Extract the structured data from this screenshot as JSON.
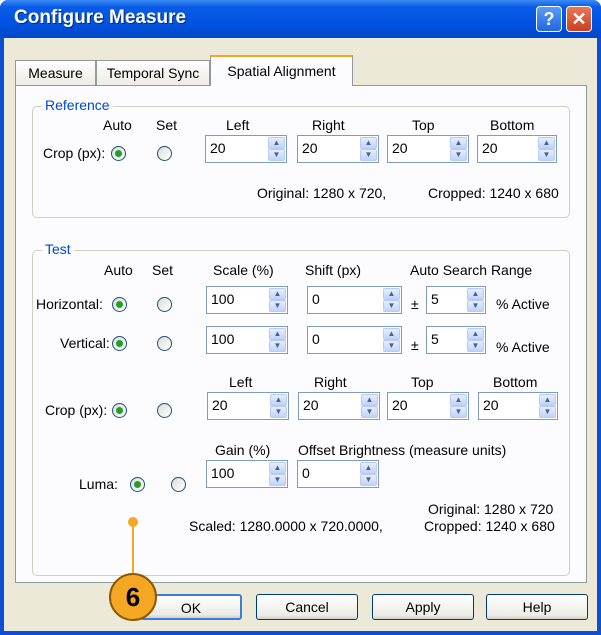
{
  "window": {
    "title": "Configure Measure",
    "help_glyph": "?",
    "close_glyph": "✕"
  },
  "tabs": [
    {
      "label": "Measure"
    },
    {
      "label": "Temporal Sync"
    },
    {
      "label": "Spatial Alignment"
    }
  ],
  "reference": {
    "group_label": "Reference",
    "col_auto": "Auto",
    "col_set": "Set",
    "col_left": "Left",
    "col_right": "Right",
    "col_top": "Top",
    "col_bottom": "Bottom",
    "crop_label": "Crop (px):",
    "crop_mode": "auto",
    "crop_values": {
      "left": "20",
      "right": "20",
      "top": "20",
      "bottom": "20"
    },
    "original_text": "Original: 1280 x 720,",
    "cropped_text": "Cropped: 1240 x 680"
  },
  "test": {
    "group_label": "Test",
    "col_auto": "Auto",
    "col_set": "Set",
    "col_scale": "Scale (%)",
    "col_shift": "Shift (px)",
    "col_search": "Auto Search Range",
    "horizontal": {
      "label": "Horizontal:",
      "mode": "auto",
      "scale": "100",
      "shift": "0",
      "pm": "±",
      "range": "5",
      "unit": "% Active"
    },
    "vertical": {
      "label": "Vertical:",
      "mode": "auto",
      "scale": "100",
      "shift": "0",
      "pm": "±",
      "range": "5",
      "unit": "% Active"
    },
    "col_left": "Left",
    "col_right": "Right",
    "col_top": "Top",
    "col_bottom": "Bottom",
    "crop_label": "Crop (px):",
    "crop_mode": "auto",
    "crop_values": {
      "left": "20",
      "right": "20",
      "top": "20",
      "bottom": "20"
    },
    "col_gain": "Gain (%)",
    "col_offset": "Offset Brightness (measure units)",
    "luma": {
      "label": "Luma:",
      "mode": "auto",
      "gain": "100",
      "offset": "0"
    },
    "original_text": "Original: 1280 x 720",
    "scaled_text": "Scaled: 1280.0000 x 720.0000,",
    "cropped_text": "Cropped: 1240 x 680"
  },
  "buttons": {
    "ok": "OK",
    "cancel": "Cancel",
    "apply": "Apply",
    "help": "Help"
  },
  "callout": {
    "number": "6"
  },
  "spin_glyphs": {
    "up": "▲",
    "down": "▼"
  }
}
